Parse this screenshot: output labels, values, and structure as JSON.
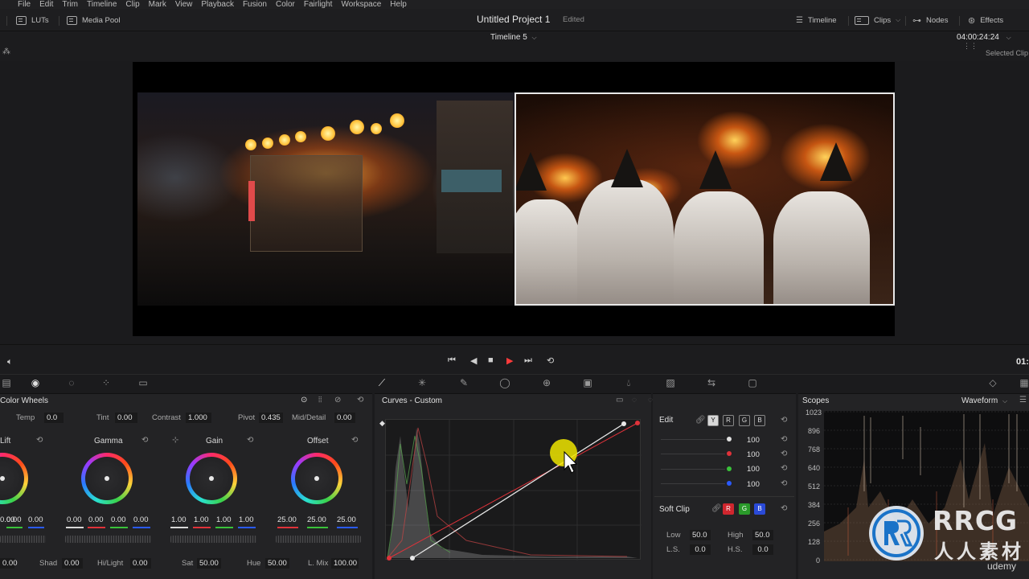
{
  "menu": [
    "File",
    "Edit",
    "Trim",
    "Timeline",
    "Clip",
    "Mark",
    "View",
    "Playback",
    "Fusion",
    "Color",
    "Fairlight",
    "Workspace",
    "Help"
  ],
  "toolbar": {
    "luts_label": "LUTs",
    "media_pool_label": "Media Pool",
    "project_title": "Untitled Project 1",
    "project_status": "Edited",
    "timeline_label": "Timeline",
    "clips_label": "Clips",
    "nodes_label": "Nodes",
    "effects_label": "Effects"
  },
  "viewer": {
    "timeline_name": "Timeline 5",
    "timecode": "04:00:24:24",
    "selected_clip": "Selected Clip",
    "transport_tc": "01:"
  },
  "color_wheels": {
    "title": "Color Wheels",
    "temp_label": "Temp",
    "temp_value": "0.0",
    "tint_label": "Tint",
    "tint_value": "0.00",
    "contrast_label": "Contrast",
    "contrast_value": "1.000",
    "pivot_label": "Pivot",
    "pivot_value": "0.435",
    "middetail_label": "Mid/Detail",
    "middetail_value": "0.00",
    "wheels": [
      {
        "name": "Lift",
        "values": [
          "0.00",
          "0.00",
          "0.00"
        ]
      },
      {
        "name": "Gamma",
        "values": [
          "0.00",
          "0.00",
          "0.00",
          "0.00"
        ]
      },
      {
        "name": "Gain",
        "values": [
          "1.00",
          "1.00",
          "1.00",
          "1.00"
        ]
      },
      {
        "name": "Offset",
        "values": [
          "25.00",
          "25.00",
          "25.00"
        ]
      }
    ],
    "bottom": {
      "first_value": "0.00",
      "shad_label": "Shad",
      "shad_value": "0.00",
      "hilight_label": "Hi/Light",
      "hilight_value": "0.00",
      "sat_label": "Sat",
      "sat_value": "50.00",
      "hue_label": "Hue",
      "hue_value": "50.00",
      "lmix_label": "L. Mix",
      "lmix_value": "100.00"
    }
  },
  "curves": {
    "title": "Curves - Custom"
  },
  "edit": {
    "title": "Edit",
    "channels": [
      "Y",
      "R",
      "G",
      "B"
    ],
    "rows": [
      {
        "color": "#e0e0e0",
        "value": "100"
      },
      {
        "color": "#e0323a",
        "value": "100"
      },
      {
        "color": "#3ac23a",
        "value": "100"
      },
      {
        "color": "#2a5aff",
        "value": "100"
      }
    ],
    "soft_clip_label": "Soft Clip",
    "soft_clip_channels": [
      "R",
      "G",
      "B"
    ],
    "low_label": "Low",
    "low_value": "50.0",
    "high_label": "High",
    "high_value": "50.0",
    "ls_label": "L.S.",
    "ls_value": "0.0",
    "hs_label": "H.S.",
    "hs_value": "0.0"
  },
  "scopes": {
    "title": "Scopes",
    "mode": "Waveform",
    "y_ticks": [
      "1023",
      "896",
      "768",
      "640",
      "512",
      "384",
      "256",
      "128",
      "0"
    ]
  },
  "watermark": {
    "brand": "RRCG",
    "subtitle": "人人素材",
    "udemy": "udemy"
  }
}
